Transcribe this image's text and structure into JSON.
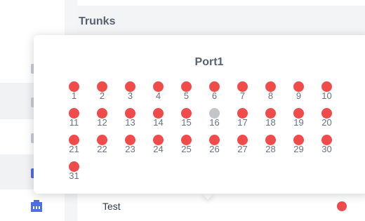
{
  "header": {
    "title": "Trunks"
  },
  "row": {
    "label": "Test",
    "status_color": "#f04b4b"
  },
  "popup": {
    "title": "Port1",
    "ports": [
      {
        "number": "1",
        "status": "red"
      },
      {
        "number": "2",
        "status": "red"
      },
      {
        "number": "3",
        "status": "red"
      },
      {
        "number": "4",
        "status": "red"
      },
      {
        "number": "5",
        "status": "red"
      },
      {
        "number": "6",
        "status": "red"
      },
      {
        "number": "7",
        "status": "red"
      },
      {
        "number": "8",
        "status": "red"
      },
      {
        "number": "9",
        "status": "red"
      },
      {
        "number": "10",
        "status": "red"
      },
      {
        "number": "11",
        "status": "red"
      },
      {
        "number": "12",
        "status": "red"
      },
      {
        "number": "13",
        "status": "red"
      },
      {
        "number": "14",
        "status": "red"
      },
      {
        "number": "15",
        "status": "red"
      },
      {
        "number": "16",
        "status": "gray"
      },
      {
        "number": "17",
        "status": "red"
      },
      {
        "number": "18",
        "status": "red"
      },
      {
        "number": "19",
        "status": "red"
      },
      {
        "number": "20",
        "status": "red"
      },
      {
        "number": "21",
        "status": "red"
      },
      {
        "number": "22",
        "status": "red"
      },
      {
        "number": "23",
        "status": "red"
      },
      {
        "number": "24",
        "status": "red"
      },
      {
        "number": "25",
        "status": "red"
      },
      {
        "number": "26",
        "status": "red"
      },
      {
        "number": "27",
        "status": "red"
      },
      {
        "number": "28",
        "status": "red"
      },
      {
        "number": "29",
        "status": "red"
      },
      {
        "number": "30",
        "status": "red"
      },
      {
        "number": "31",
        "status": "red"
      }
    ]
  },
  "colors": {
    "red": "#f04b4b",
    "gray": "#c3c5ca",
    "accent": "#4f6fe0"
  }
}
